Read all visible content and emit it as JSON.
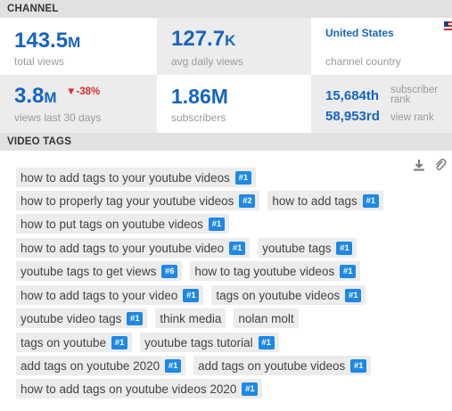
{
  "channel_header": "CHANNEL",
  "stats": {
    "total_views": {
      "value": "143.5",
      "unit": "M",
      "label": "total views"
    },
    "avg_daily_views": {
      "value": "127.7",
      "unit": "K",
      "label": "avg daily views"
    },
    "country": {
      "value": "United States",
      "label": "channel country"
    },
    "views_30_days": {
      "value": "3.8",
      "unit": "M",
      "delta": "▼-38%",
      "label": "views last 30 days"
    },
    "subscribers": {
      "value": "1.86M",
      "label": "subscribers"
    },
    "subscriber_rank": {
      "value": "15,684th",
      "label_line1": "subscriber",
      "label_line2": "rank"
    },
    "view_rank": {
      "value": "58,953rd",
      "label": "view rank"
    }
  },
  "tags_header": "VIDEO TAGS",
  "tags": [
    [
      {
        "text": "how to add tags to your youtube videos",
        "badge": "#1"
      }
    ],
    [
      {
        "text": "how to properly tag your youtube videos",
        "badge": "#2"
      },
      {
        "text": "how to add tags",
        "badge": "#1"
      }
    ],
    [
      {
        "text": "how to put tags on youtube videos",
        "badge": "#1"
      }
    ],
    [
      {
        "text": "how to add tags to your youtube video",
        "badge": "#1"
      },
      {
        "text": "youtube tags",
        "badge": "#1"
      }
    ],
    [
      {
        "text": "youtube tags to get views",
        "badge": "#6"
      },
      {
        "text": "how to tag youtube videos",
        "badge": "#1"
      }
    ],
    [
      {
        "text": "how to add tags to your video",
        "badge": "#1"
      },
      {
        "text": "tags on youtube videos",
        "badge": "#1"
      }
    ],
    [
      {
        "text": "youtube video tags",
        "badge": "#1"
      },
      {
        "text": "think media",
        "badge": ""
      },
      {
        "text": "nolan molt",
        "badge": ""
      }
    ],
    [
      {
        "text": "tags on youtube",
        "badge": "#1"
      },
      {
        "text": "youtube tags tutorial",
        "badge": "#1"
      }
    ],
    [
      {
        "text": "add tags on youtube 2020",
        "badge": "#1"
      },
      {
        "text": "add tags on youtube videos",
        "badge": "#1"
      }
    ],
    [
      {
        "text": "how to add tags on youtube videos 2020",
        "badge": "#1"
      }
    ]
  ],
  "icons": {
    "download": "download-icon",
    "attach": "paperclip-icon",
    "flag": "us-flag-icon"
  },
  "colors": {
    "accent": "#1565c0",
    "badge": "#1e88e5",
    "negative": "#d32f2f"
  }
}
